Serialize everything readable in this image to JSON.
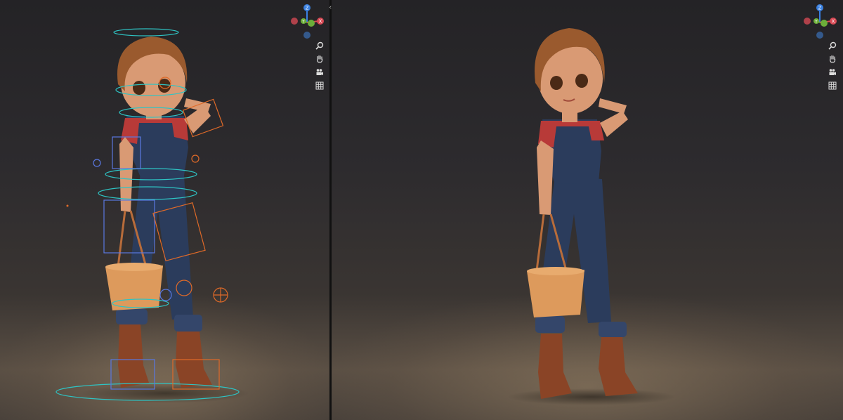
{
  "viewports": [
    {
      "name": "rig-view",
      "description": "",
      "gizmo": {
        "axes": [
          "Z",
          "Y",
          "X"
        ],
        "colors": {
          "x": "#d94a55",
          "y": "#6cae3a",
          "z": "#3a80e0"
        }
      },
      "nav_tools": [
        "zoom-icon",
        "hand-pan-icon",
        "camera-icon",
        "grid-icon"
      ]
    },
    {
      "name": "render-view",
      "description": "",
      "gizmo": {
        "axes": [
          "Z",
          "Y",
          "X"
        ],
        "colors": {
          "x": "#d94a55",
          "y": "#6cae3a",
          "z": "#3a80e0"
        }
      },
      "nav_tools": [
        "zoom-icon",
        "hand-pan-icon",
        "camera-icon",
        "grid-icon"
      ]
    }
  ],
  "gizmo_labels": {
    "z": "Z",
    "y": "Y",
    "x": "X"
  },
  "split_handle": "‹›",
  "colors": {
    "shirt": "#b83a38",
    "denim": "#2b3c5c",
    "skin": "#d99a74",
    "hair": "#9a5a2e",
    "boots": "#8a4426",
    "bucket": "#dd9a5c",
    "rig_cyan": "#2ec4c4",
    "rig_orange": "#e06a28",
    "rig_blue": "#5a78e0"
  }
}
